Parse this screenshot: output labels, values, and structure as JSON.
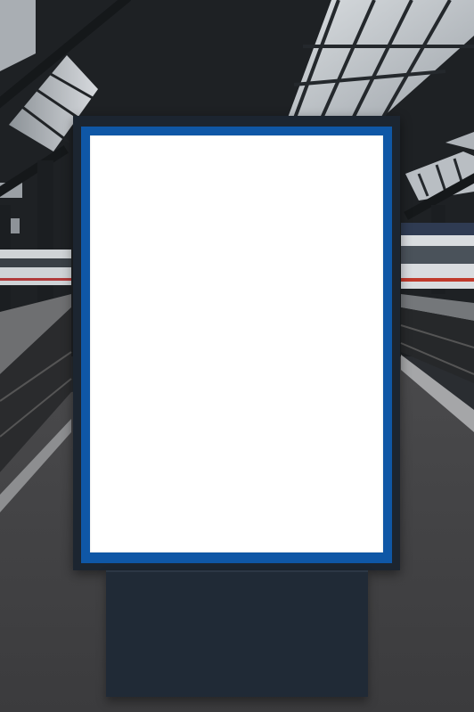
{
  "scene": {
    "description_tags": [
      "train-station-platform",
      "blank-billboard"
    ],
    "colors": {
      "billboard_frame": "#1c2530",
      "billboard_border": "#0f57a6",
      "billboard_screen": "#ffffff",
      "stand": "#202a36"
    }
  }
}
